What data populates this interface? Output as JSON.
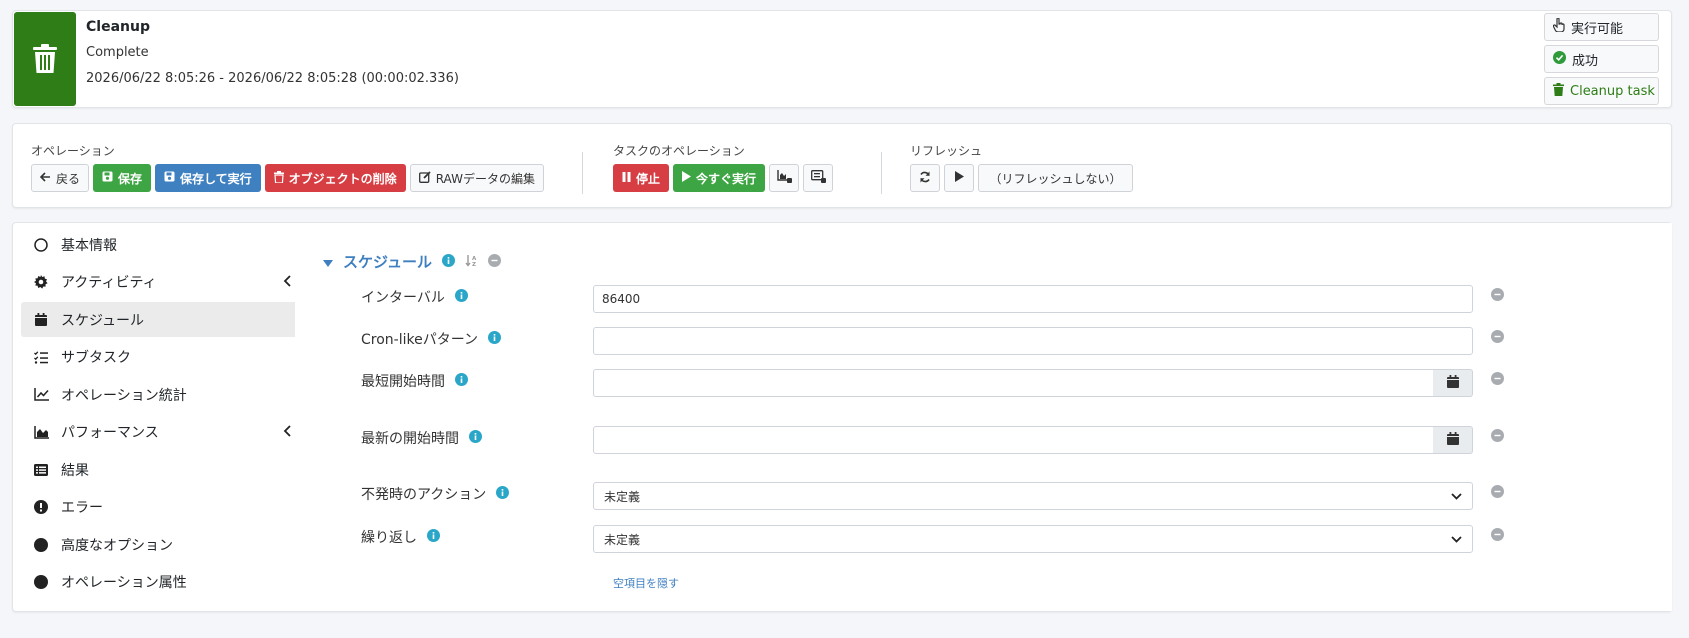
{
  "header": {
    "title": "Cleanup",
    "status": "Complete",
    "time_range": "2026/06/22 8:05:26 - 2026/06/22 8:05:28 (00:00:02.336)",
    "badges": [
      {
        "label": "実行可能",
        "icon": "hand-pointer-icon"
      },
      {
        "label": "成功",
        "icon": "check-circle-icon"
      },
      {
        "label": "Cleanup task",
        "icon": "trash-icon"
      }
    ],
    "colors": {
      "icon_bg": "#2e7d16",
      "success": "#2e7d16"
    }
  },
  "operations": {
    "label": "オペレーション",
    "back": "戻る",
    "save": "保存",
    "save_run": "保存して実行",
    "delete": "オブジェクトの削除",
    "edit_raw": "RAWデータの編集"
  },
  "task_ops": {
    "label": "タスクのオペレーション",
    "stop": "停止",
    "run_now": "今すぐ実行"
  },
  "refresh": {
    "label": "リフレッシュ",
    "selection": "（リフレッシュしない）"
  },
  "sidebar": {
    "items": [
      {
        "label": "基本情報",
        "icon": "circle-outline-icon"
      },
      {
        "label": "アクティビティ",
        "icon": "gear-icon",
        "expandable": true
      },
      {
        "label": "スケジュール",
        "icon": "calendar-icon",
        "active": true
      },
      {
        "label": "サブタスク",
        "icon": "list-check-icon"
      },
      {
        "label": "オペレーション統計",
        "icon": "line-chart-icon"
      },
      {
        "label": "パフォーマンス",
        "icon": "area-chart-icon",
        "expandable": true
      },
      {
        "label": "結果",
        "icon": "list-icon"
      },
      {
        "label": "エラー",
        "icon": "exclamation-circle-icon"
      },
      {
        "label": "高度なオプション",
        "icon": "filled-circle-icon"
      },
      {
        "label": "オペレーション属性",
        "icon": "filled-circle-icon"
      }
    ]
  },
  "schedule": {
    "title": "スケジュール",
    "fields": {
      "interval": {
        "label": "インターバル",
        "value": "86400"
      },
      "cron": {
        "label": "Cron-likeパターン",
        "value": ""
      },
      "earliest": {
        "label": "最短開始時間",
        "value": ""
      },
      "latest": {
        "label": "最新の開始時間",
        "value": ""
      },
      "misfire": {
        "label": "不発時のアクション",
        "value": "未定義"
      },
      "recurrence": {
        "label": "繰り返し",
        "value": "未定義"
      }
    },
    "hide_empty": "空項目を隠す"
  }
}
